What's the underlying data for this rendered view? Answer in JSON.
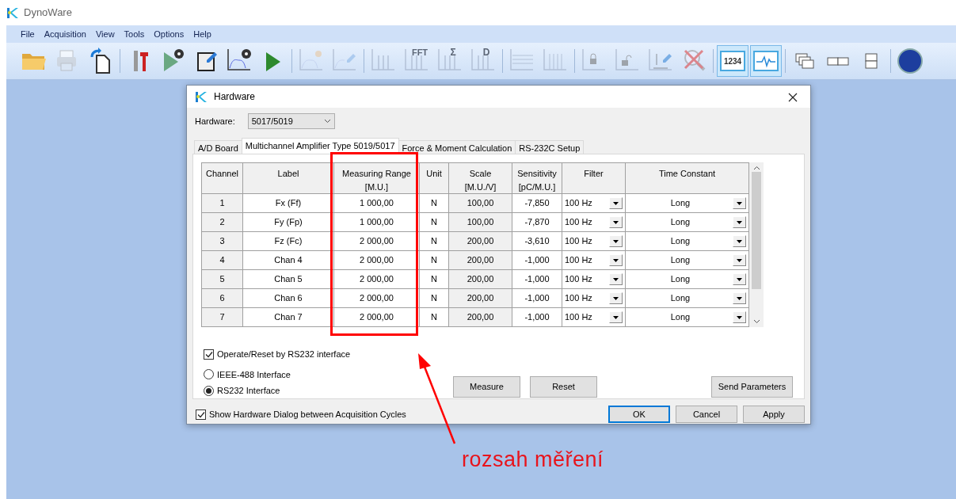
{
  "window": {
    "title": "DynoWare"
  },
  "menu": [
    "File",
    "Acquisition",
    "View",
    "Tools",
    "Options",
    "Help"
  ],
  "toolbar": [
    {
      "kind": "folder",
      "disabled": false
    },
    {
      "kind": "printer",
      "disabled": true
    },
    {
      "kind": "copy",
      "disabled": false
    },
    {
      "kind": "separator"
    },
    {
      "kind": "tools",
      "disabled": false
    },
    {
      "kind": "play-gear",
      "disabled": false
    },
    {
      "kind": "edit",
      "disabled": false
    },
    {
      "kind": "chart-gear",
      "disabled": false
    },
    {
      "kind": "play",
      "disabled": false
    },
    {
      "kind": "separator"
    },
    {
      "kind": "chart-star",
      "disabled": true
    },
    {
      "kind": "chart-pen",
      "disabled": true
    },
    {
      "kind": "separator"
    },
    {
      "kind": "bars",
      "disabled": true
    },
    {
      "kind": "bars",
      "disabled": true,
      "text": "FFT"
    },
    {
      "kind": "bars",
      "disabled": true,
      "text": "Σ"
    },
    {
      "kind": "bars",
      "disabled": true,
      "text": "D"
    },
    {
      "kind": "separator"
    },
    {
      "kind": "hlines",
      "disabled": true
    },
    {
      "kind": "vlines",
      "disabled": true
    },
    {
      "kind": "separator"
    },
    {
      "kind": "lock",
      "disabled": true
    },
    {
      "kind": "unlock",
      "disabled": true
    },
    {
      "kind": "axes-pen",
      "disabled": true
    },
    {
      "kind": "no-zoom",
      "disabled": true
    },
    {
      "kind": "separator"
    },
    {
      "kind": "counter",
      "disabled": false,
      "on": true,
      "text": "1234"
    },
    {
      "kind": "wave",
      "disabled": false,
      "on": true
    },
    {
      "kind": "separator"
    },
    {
      "kind": "cascade",
      "disabled": false
    },
    {
      "kind": "tile-h",
      "disabled": false
    },
    {
      "kind": "tile-v",
      "disabled": false
    },
    {
      "kind": "separator"
    },
    {
      "kind": "help",
      "disabled": false
    }
  ],
  "dialog": {
    "title": "Hardware",
    "hardware_label": "Hardware:",
    "hardware_value": "5017/5019",
    "tabs": [
      {
        "label": "A/D Board",
        "selected": false
      },
      {
        "label": "Multichannel Amplifier Type 5019/5017",
        "selected": true
      },
      {
        "label": "Force & Moment Calculation",
        "selected": false
      },
      {
        "label": "RS-232C Setup",
        "selected": false
      }
    ],
    "table": {
      "columns": [
        {
          "lines": [
            "Channel"
          ],
          "kind": "text",
          "readonly": true
        },
        {
          "lines": [
            "Label"
          ],
          "kind": "text",
          "readonly": false
        },
        {
          "lines": [
            "Measuring Range",
            "[M.U.]"
          ],
          "kind": "text",
          "readonly": false
        },
        {
          "lines": [
            "Unit"
          ],
          "kind": "text",
          "readonly": false
        },
        {
          "lines": [
            "Scale",
            "[M.U./V]"
          ],
          "kind": "text",
          "readonly": true
        },
        {
          "lines": [
            "Sensitivity",
            "[pC/M.U.]"
          ],
          "kind": "text",
          "readonly": false
        },
        {
          "lines": [
            "Filter"
          ],
          "kind": "combo",
          "readonly": false
        },
        {
          "lines": [
            "Time Constant"
          ],
          "kind": "combo",
          "readonly": false
        }
      ],
      "rows": [
        [
          "1",
          "Fx (Ff)",
          "1 000,00",
          "N",
          "100,00",
          "-7,850",
          "100 Hz",
          "Long"
        ],
        [
          "2",
          "Fy (Fp)",
          "1 000,00",
          "N",
          "100,00",
          "-7,870",
          "100 Hz",
          "Long"
        ],
        [
          "3",
          "Fz (Fc)",
          "2 000,00",
          "N",
          "200,00",
          "-3,610",
          "100 Hz",
          "Long"
        ],
        [
          "4",
          "Chan 4",
          "2 000,00",
          "N",
          "200,00",
          "-1,000",
          "100 Hz",
          "Long"
        ],
        [
          "5",
          "Chan 5",
          "2 000,00",
          "N",
          "200,00",
          "-1,000",
          "100 Hz",
          "Long"
        ],
        [
          "6",
          "Chan 6",
          "2 000,00",
          "N",
          "200,00",
          "-1,000",
          "100 Hz",
          "Long"
        ],
        [
          "7",
          "Chan 7",
          "2 000,00",
          "N",
          "200,00",
          "-1,000",
          "100 Hz",
          "Long"
        ]
      ]
    },
    "operate_reset": {
      "label": "Operate/Reset by RS232 interface",
      "checked": true
    },
    "interfaces": [
      {
        "label": "IEEE-488 Interface",
        "selected": false
      },
      {
        "label": "RS232 Interface",
        "selected": true
      }
    ],
    "panel_buttons": [
      "Measure",
      "Reset",
      "Send Parameters"
    ],
    "show_dialog": {
      "label": "Show Hardware Dialog between Acquisition Cycles",
      "checked": true
    },
    "buttons": [
      {
        "label": "OK",
        "default": true
      },
      {
        "label": "Cancel",
        "default": false
      },
      {
        "label": "Apply",
        "default": false
      }
    ]
  },
  "annotation": {
    "text": "rozsah měření"
  }
}
